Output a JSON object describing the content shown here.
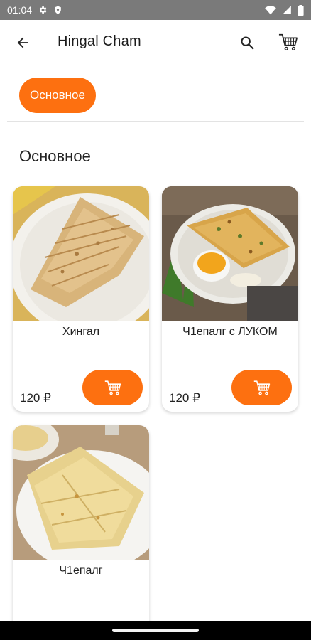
{
  "status_bar": {
    "time": "01:04",
    "icons": [
      "gear-icon",
      "shield-icon",
      "wifi-icon",
      "signal-icon",
      "battery-icon"
    ]
  },
  "app_bar": {
    "title": "Hingal Cham",
    "back_icon": "arrow-left-icon",
    "search_icon": "search-icon",
    "cart_icon": "cart-icon"
  },
  "categories": [
    {
      "label": "Основное",
      "selected": true
    }
  ],
  "section": {
    "title": "Основное"
  },
  "products": [
    {
      "name": "Хингал",
      "price": "120 ₽",
      "image": "khingal-photo"
    },
    {
      "name": "Ч1епалг с ЛУКОМ",
      "price": "120 ₽",
      "image": "chepalg-with-onion-photo"
    },
    {
      "name": "Ч1епалг",
      "price": "",
      "image": "chepalg-photo"
    }
  ],
  "colors": {
    "accent": "#fd7010",
    "status_bar": "#7a7a7a",
    "nav_bar": "#000000"
  }
}
